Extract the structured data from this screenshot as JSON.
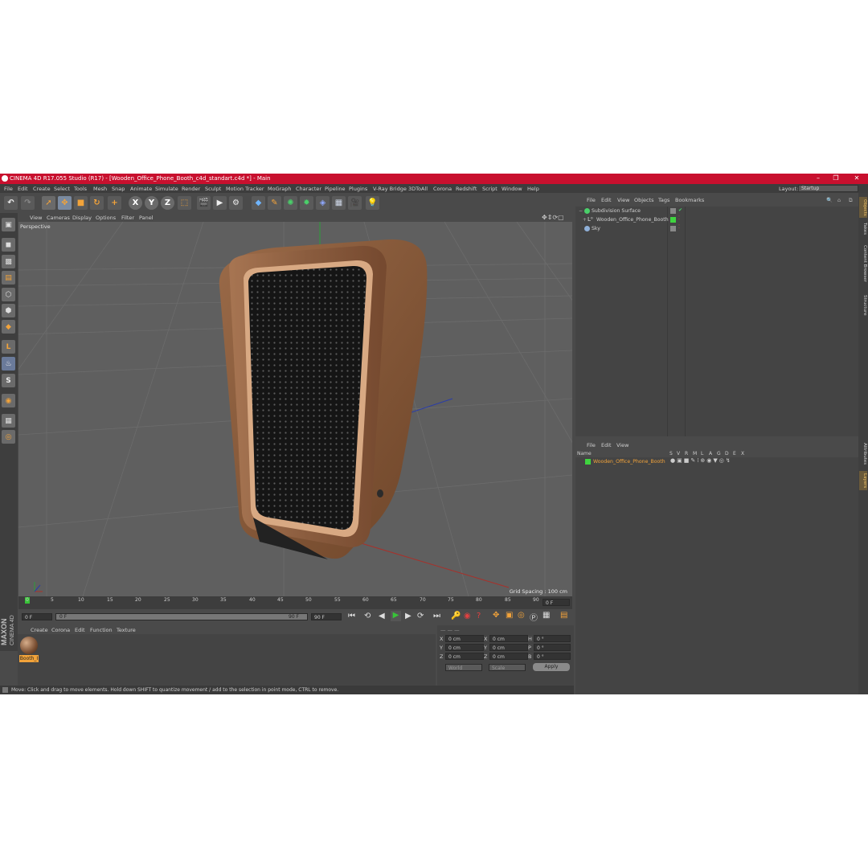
{
  "window": {
    "title": "CINEMA 4D R17.055 Studio (R17) - [Wooden_Office_Phone_Booth_c4d_standart.c4d *] - Main",
    "controls": [
      "–",
      "❐",
      "✕"
    ]
  },
  "menubar": {
    "items": [
      "File",
      "Edit",
      "Create",
      "Select",
      "Tools",
      "Mesh",
      "Snap",
      "Animate",
      "Simulate",
      "Render",
      "Sculpt",
      "Motion Tracker",
      "MoGraph",
      "Character",
      "Pipeline",
      "Plugins",
      "V-Ray Bridge",
      "3DToAll",
      "Corona",
      "Redshift",
      "Script",
      "Window",
      "Help"
    ],
    "layout_label": "Layout:",
    "layout_value": "Startup"
  },
  "viewport": {
    "menu": [
      "View",
      "Cameras",
      "Display",
      "Options",
      "Filter",
      "Panel"
    ],
    "camera_label": "Perspective",
    "grid_spacing": "Grid Spacing : 100 cm"
  },
  "timeline": {
    "ticks": [
      "0",
      "5",
      "10",
      "15",
      "20",
      "25",
      "30",
      "35",
      "40",
      "45",
      "50",
      "55",
      "60",
      "65",
      "70",
      "75",
      "80",
      "85",
      "90"
    ],
    "end_frame_field": "0 F",
    "start_field": "0 F",
    "range_start": "0 F",
    "range_end": "90 F",
    "end_field": "90 F"
  },
  "material_manager": {
    "menu": [
      "Create",
      "Corona",
      "Edit",
      "Function",
      "Texture"
    ],
    "materials": [
      {
        "label": "Booth_I"
      }
    ]
  },
  "coordinates": {
    "rows": [
      {
        "a": "X",
        "av": "0 cm",
        "b": "X",
        "bv": "0 cm",
        "c": "H",
        "cv": "0 °"
      },
      {
        "a": "Y",
        "av": "0 cm",
        "b": "Y",
        "bv": "0 cm",
        "c": "P",
        "cv": "0 °"
      },
      {
        "a": "Z",
        "av": "0 cm",
        "b": "Z",
        "bv": "0 cm",
        "c": "B",
        "cv": "0 °"
      }
    ],
    "mode1": "World",
    "mode2": "Scale",
    "apply": "Apply"
  },
  "status": "Move: Click and drag to move elements. Hold down SHIFT to quantize movement / add to the selection in point mode, CTRL to remove.",
  "object_manager": {
    "menu": [
      "File",
      "Edit",
      "View",
      "Objects",
      "Tags",
      "Bookmarks"
    ],
    "objects": [
      {
        "name": "Subdivision Surface"
      },
      {
        "name": "Wooden_Office_Phone_Booth"
      },
      {
        "name": "Sky"
      }
    ]
  },
  "layer_manager": {
    "menu": [
      "File",
      "Edit",
      "View"
    ],
    "header_name": "Name",
    "columns": [
      "S",
      "V",
      "R",
      "M",
      "L",
      "A",
      "G",
      "D",
      "E",
      "X"
    ],
    "layers": [
      {
        "name": "Wooden_Office_Phone_Booth",
        "color": "#3fd43f"
      }
    ]
  },
  "side_tabs": [
    "Objects",
    "Takes",
    "Content Browser",
    "Structure",
    "Attributes",
    "Layers"
  ],
  "brand": {
    "maxon": "MAXON",
    "product": "CINEMA 4D"
  },
  "colors": {
    "titlebar": "#c8102e",
    "accent": "#f2a33a",
    "viewport_bg": "#5f5f5f"
  }
}
